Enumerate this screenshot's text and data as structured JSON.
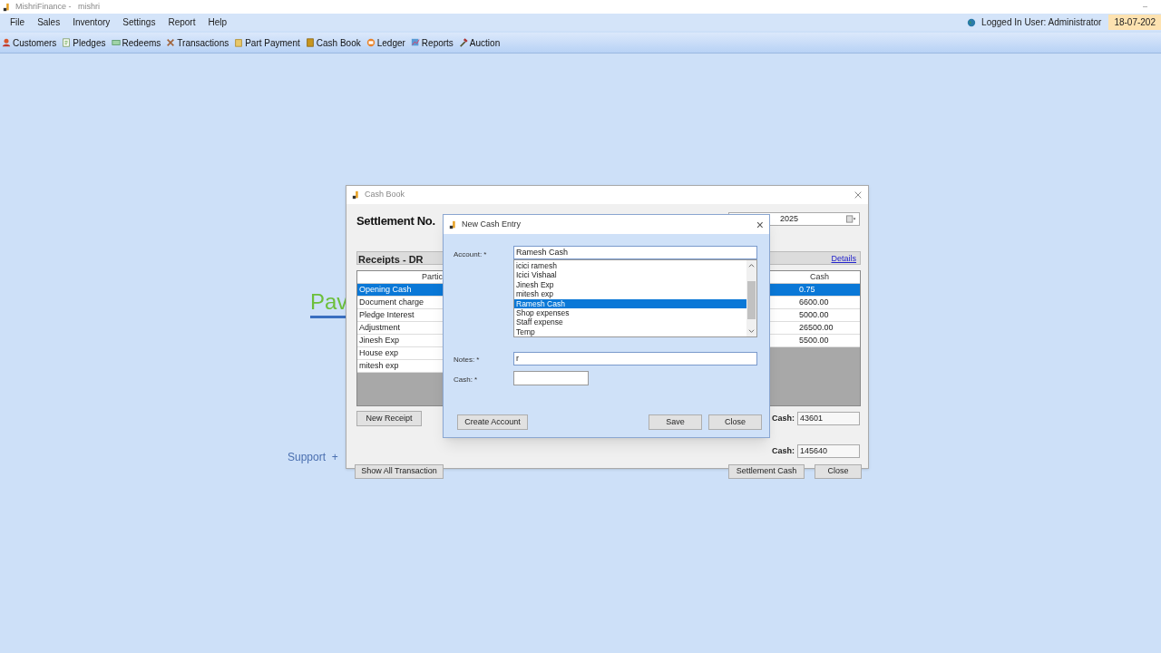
{
  "app": {
    "title": "MishriFinance -   mishri",
    "minimize": "–"
  },
  "menu": [
    "File",
    "Sales",
    "Inventory",
    "Settings",
    "Report",
    "Help"
  ],
  "status": {
    "user": "Logged In User: Administrator",
    "date": "18-07-202"
  },
  "toolbar": [
    "Customers",
    "Pledges",
    "Redeems",
    "Transactions",
    "Part Payment",
    "Cash Book",
    "Ledger",
    "Reports",
    "Auction"
  ],
  "background": {
    "logo": "Pav",
    "support": "Support  +"
  },
  "cash_book": {
    "title": "Cash Book",
    "heading": "Settlement No.",
    "date": "2025",
    "receipts": {
      "title": "Receipts - DR",
      "column": "Partic",
      "rows": [
        {
          "text": "Opening Cash",
          "selected": true
        },
        {
          "text": "Document charge",
          "selected": false
        },
        {
          "text": "Pledge Interest",
          "selected": false
        },
        {
          "text": "Adjustment",
          "selected": false
        },
        {
          "text": "Jinesh Exp",
          "selected": false
        },
        {
          "text": "House exp",
          "selected": false
        },
        {
          "text": "mitesh exp",
          "selected": false
        }
      ]
    },
    "details_link": "Details",
    "payments": {
      "column": "Cash",
      "rows": [
        {
          "text": "0.75",
          "selected": true
        },
        {
          "text": "6600.00",
          "selected": false
        },
        {
          "text": "5000.00",
          "selected": false
        },
        {
          "text": "26500.00",
          "selected": false
        },
        {
          "text": "5500.00",
          "selected": false
        }
      ]
    },
    "new_receipt": "New Receipt",
    "totals": [
      {
        "label": "Cash:",
        "value": "43601"
      },
      {
        "label": "Cash:",
        "value": "145640"
      }
    ],
    "buttons": [
      "Show All Transaction",
      "Settlement Cash",
      "Close"
    ]
  },
  "dialog": {
    "title": "New Cash Entry",
    "close": "×",
    "account": {
      "label": "Account: *",
      "value": "Ramesh Cash",
      "options": [
        {
          "text": "icici ramesh",
          "selected": false
        },
        {
          "text": "Icici Vishaal",
          "selected": false
        },
        {
          "text": "Jinesh Exp",
          "selected": false
        },
        {
          "text": "mitesh exp",
          "selected": false
        },
        {
          "text": "Ramesh Cash",
          "selected": true
        },
        {
          "text": "Shop expenses",
          "selected": false
        },
        {
          "text": "Staff expense",
          "selected": false
        },
        {
          "text": "Temp",
          "selected": false
        }
      ]
    },
    "notes": {
      "label": "Notes: *",
      "value": "r"
    },
    "cash": {
      "label": "Cash: *"
    },
    "buttons": [
      "Create Account",
      "Save",
      "Close"
    ]
  }
}
